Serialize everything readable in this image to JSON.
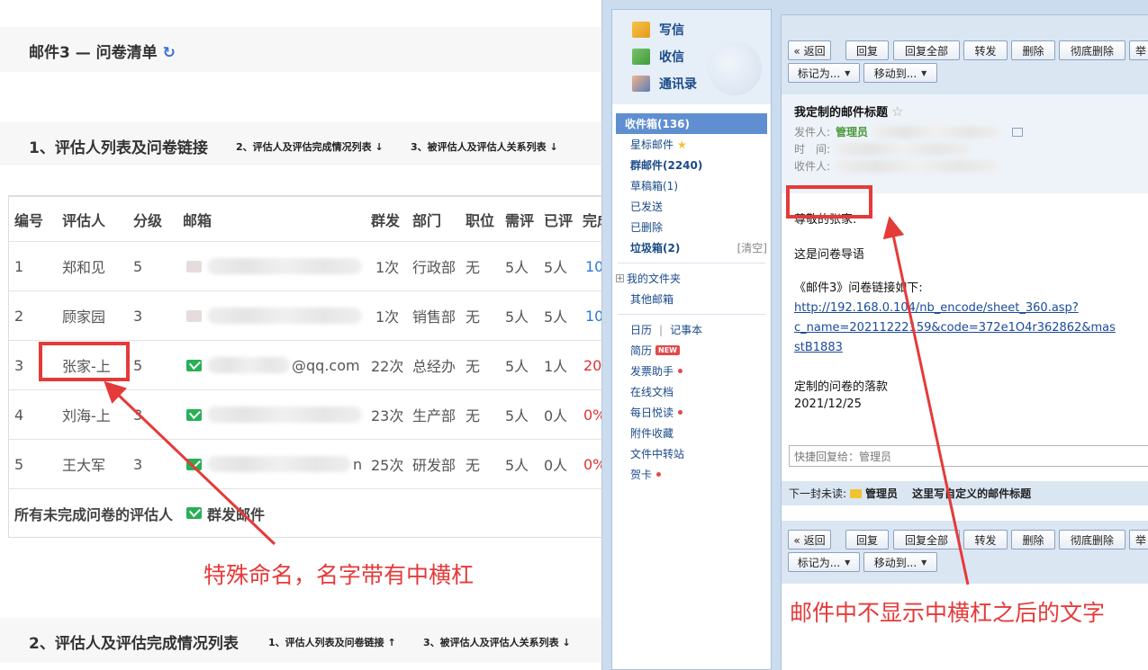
{
  "left": {
    "page_title": "邮件3 — 问卷清单",
    "refresh_icon": "↻",
    "section1": {
      "title": "1、评估人列表及问卷链接",
      "link_a": "2、评估人及评估完成情况列表 ↓",
      "link_b": "3、被评估人及评估人关系列表 ↓"
    },
    "table": {
      "headers": [
        "编号",
        "评估人",
        "分级",
        "邮箱",
        "群发",
        "部门",
        "职位",
        "需评",
        "已评",
        "完成"
      ],
      "rows": [
        {
          "no": "1",
          "name": "郑和见",
          "level": "5",
          "email_suffix": "",
          "sent": "1次",
          "dept": "行政部",
          "pos": "无",
          "need": "5人",
          "done": "5人",
          "pct": "10"
        },
        {
          "no": "2",
          "name": "顾家园",
          "level": "3",
          "email_suffix": "",
          "sent": "1次",
          "dept": "销售部",
          "pos": "无",
          "need": "5人",
          "done": "5人",
          "pct": "10"
        },
        {
          "no": "3",
          "name": "张家-上",
          "level": "5",
          "email_suffix": "@qq.com",
          "sent": "22次",
          "dept": "总经办",
          "pos": "无",
          "need": "5人",
          "done": "1人",
          "pct": "20"
        },
        {
          "no": "4",
          "name": "刘海-上",
          "level": "3",
          "email_suffix": "",
          "sent": "23次",
          "dept": "生产部",
          "pos": "无",
          "need": "5人",
          "done": "0人",
          "pct": "0%"
        },
        {
          "no": "5",
          "name": "王大军",
          "level": "3",
          "email_suffix": "n",
          "sent": "25次",
          "dept": "研发部",
          "pos": "无",
          "need": "5人",
          "done": "0人",
          "pct": "0%"
        }
      ],
      "footer_label": "所有未完成问卷的评估人",
      "footer_button": "群发邮件"
    },
    "annotation_left": "特殊命名，名字带有中横杠",
    "section2": {
      "title": "2、评估人及评估完成情况列表",
      "link_a": "1、评估人列表及问卷链接 ↑",
      "link_b": "3、被评估人及评估人关系列表 ↓"
    }
  },
  "right": {
    "nav_top": {
      "write": "写信",
      "receive": "收信",
      "contacts": "通讯录"
    },
    "nav_items": {
      "inbox": "收件箱(136)",
      "starred": "星标邮件",
      "group": "群邮件(2240)",
      "drafts": "草稿箱(1)",
      "sent": "已发送",
      "deleted": "已删除",
      "junk": "垃圾箱(2)",
      "junk_clear": "[清空]",
      "my_folders": "我的文件夹",
      "other_mail": "其他邮箱",
      "calendar": "日历",
      "notepad": "记事本",
      "resume": "简历",
      "new_badge": "NEW",
      "invoice": "发票助手",
      "online_docs": "在线文档",
      "daily": "每日悦读",
      "attachments": "附件收藏",
      "transfer": "文件中转站",
      "card": "贺卡"
    },
    "toolbar": {
      "back": "« 返回",
      "reply": "回复",
      "reply_all": "回复全部",
      "forward": "转发",
      "delete": "删除",
      "delete_perm": "彻底删除",
      "report": "举",
      "mark_as": "标记为...",
      "move_to": "移动到..."
    },
    "mail": {
      "subject": "我定制的邮件标题",
      "sender_label": "发件人:",
      "sender_name": "管理员",
      "time_label": "时　间:",
      "recipient_label": "收件人:",
      "greeting": "尊敬的张家:",
      "intro": "这是问卷导语",
      "link_label": "《邮件3》问卷链接如下:",
      "link_url_1": "http://192.168.0.104/nb_encode/sheet_360.asp?",
      "link_url_2": "c_name=20211222159&code=372e1O4r362862&mas",
      "link_url_3": "stB1883",
      "sign_label": "定制的问卷的落款",
      "sign_date": "2021/12/25"
    },
    "quick_reply": "快捷回复给：管理员",
    "next_unread": {
      "label": "下一封未读:",
      "sender": "管理员",
      "subject": "这里写自定义的邮件标题"
    },
    "annotation_right": "邮件中不显示中横杠之后的文字"
  },
  "colors": {
    "annotation_red": "#e53a3a",
    "nav_active": "#5f8fd0",
    "link_blue": "#1a4a88",
    "mail_green": "#27b056"
  }
}
